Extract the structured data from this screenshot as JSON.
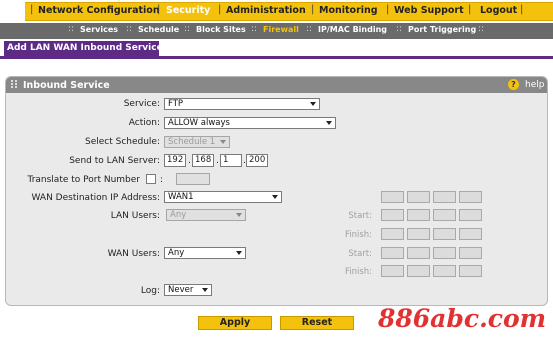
{
  "top_nav": {
    "items": [
      "Network Configuration",
      "Security",
      "Administration",
      "Monitoring",
      "Web Support",
      "Logout"
    ],
    "active": "Security"
  },
  "sub_nav": {
    "items": [
      "Services",
      "Schedule",
      "Block Sites",
      "Firewall",
      "IP/MAC Binding",
      "Port Triggering"
    ],
    "active": "Firewall"
  },
  "page_tab": "Add LAN WAN Inbound Service",
  "panel": {
    "title": "Inbound Service",
    "help_icon": "?",
    "help_label": "help"
  },
  "form": {
    "service": {
      "label": "Service:",
      "value": "FTP"
    },
    "action": {
      "label": "Action:",
      "value": "ALLOW always"
    },
    "schedule": {
      "label": "Select Schedule:",
      "value": "Schedule 1"
    },
    "lan_server": {
      "label": "Send to LAN Server:",
      "octets": [
        "192",
        "168",
        "1",
        "200"
      ],
      "dot": "."
    },
    "translate_port": {
      "label": "Translate to Port Number",
      "checked": false,
      "colon": ":"
    },
    "wan_dest": {
      "label": "WAN Destination IP Address:",
      "value": "WAN1"
    },
    "lan_users": {
      "label": "LAN Users:",
      "value": "Any"
    },
    "wan_users": {
      "label": "WAN Users:",
      "value": "Any"
    },
    "log": {
      "label": "Log:",
      "value": "Never"
    },
    "range_labels": {
      "start": "Start:",
      "finish": "Finish:"
    }
  },
  "buttons": {
    "apply": "Apply",
    "reset": "Reset"
  },
  "watermark": "886abc.com"
}
